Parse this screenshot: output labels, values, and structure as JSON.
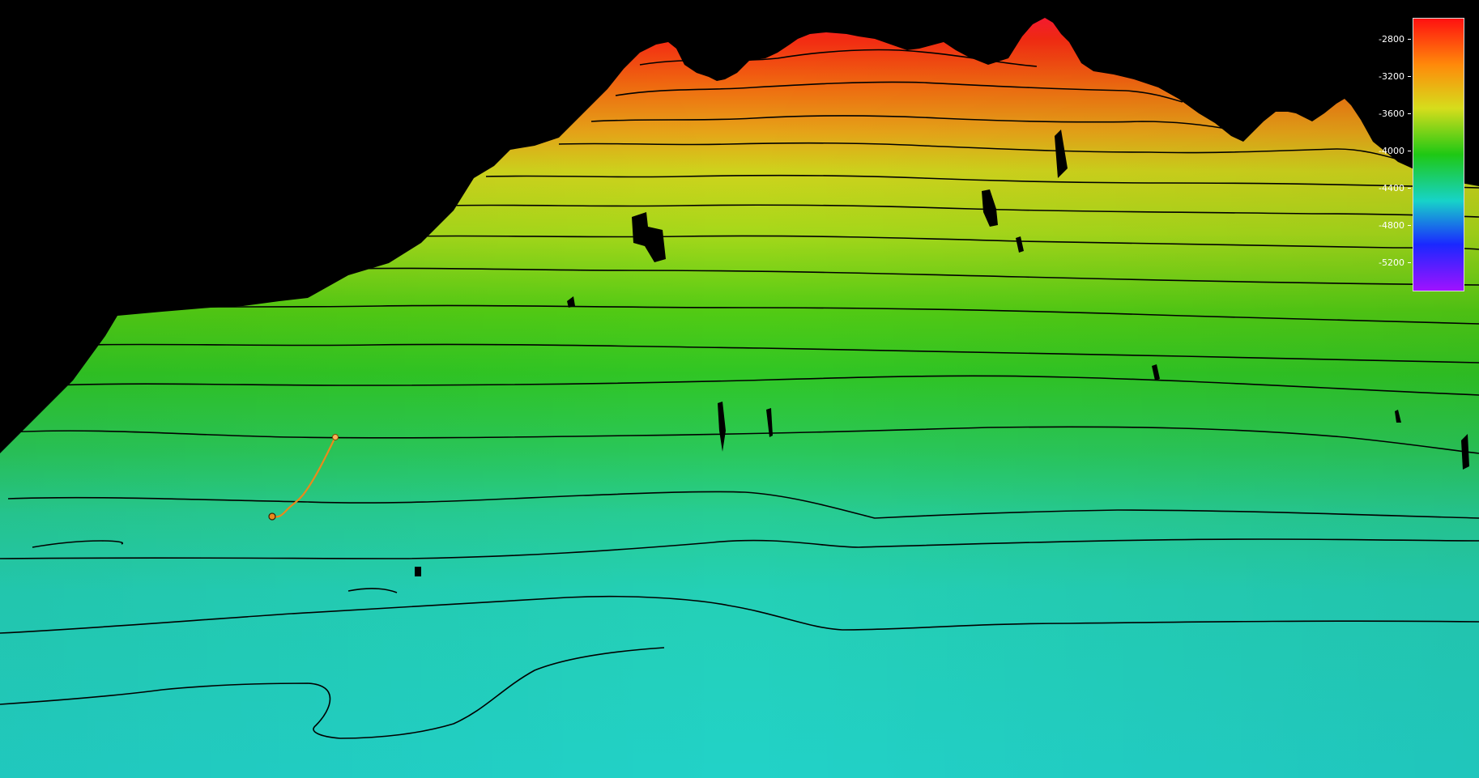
{
  "view": {
    "type": "3d-bathymetry-surface",
    "background_color": "#000000",
    "contour_color": "#000000",
    "track_color": "#e9891c"
  },
  "legend": {
    "ticks": [
      {
        "value": -2800,
        "label": "-2800"
      },
      {
        "value": -3200,
        "label": "-3200"
      },
      {
        "value": -3600,
        "label": "-3600"
      },
      {
        "value": -4000,
        "label": "-4000"
      },
      {
        "value": -4400,
        "label": "-4400"
      },
      {
        "value": -4800,
        "label": "-4800"
      },
      {
        "value": -5200,
        "label": "-5200"
      }
    ],
    "colors_top_to_bottom": [
      "#ff1010",
      "#ff8a0a",
      "#d6dd1c",
      "#1ec814",
      "#17d3c8",
      "#1a28ff",
      "#a012ff"
    ]
  }
}
